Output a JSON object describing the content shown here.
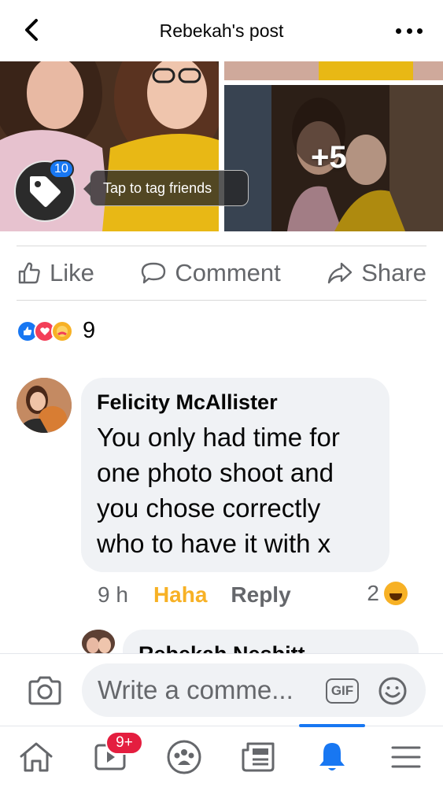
{
  "header": {
    "title": "Rebekah's post",
    "back_icon": "chevron-left-icon",
    "more_icon": "more-horizontal-icon"
  },
  "photos": {
    "more_count": "+5",
    "tag_count": "10",
    "tag_tip": "Tap to tag friends"
  },
  "actions": {
    "like": "Like",
    "comment": "Comment",
    "share": "Share"
  },
  "reactions": {
    "types": [
      "like",
      "love",
      "care"
    ],
    "count": "9"
  },
  "comment": {
    "author": "Felicity McAllister",
    "text": "You only had time for one photo shoot and you chose correctly who to have it with x",
    "time": "9 h",
    "reaction_label": "Haha",
    "reply_label": "Reply",
    "reaction_count": "2"
  },
  "reply_preview": {
    "author": "Rebekah Nesbitt"
  },
  "composer": {
    "placeholder": "Write a comme...",
    "gif_label": "GIF"
  },
  "nav": {
    "items": [
      "home",
      "watch",
      "groups",
      "news",
      "notifications",
      "menu"
    ],
    "active": "notifications",
    "watch_badge": "9+"
  },
  "colors": {
    "accent": "#1877f2",
    "haha": "#f7b125",
    "badge": "#e41e3f",
    "muted": "#65676b"
  }
}
